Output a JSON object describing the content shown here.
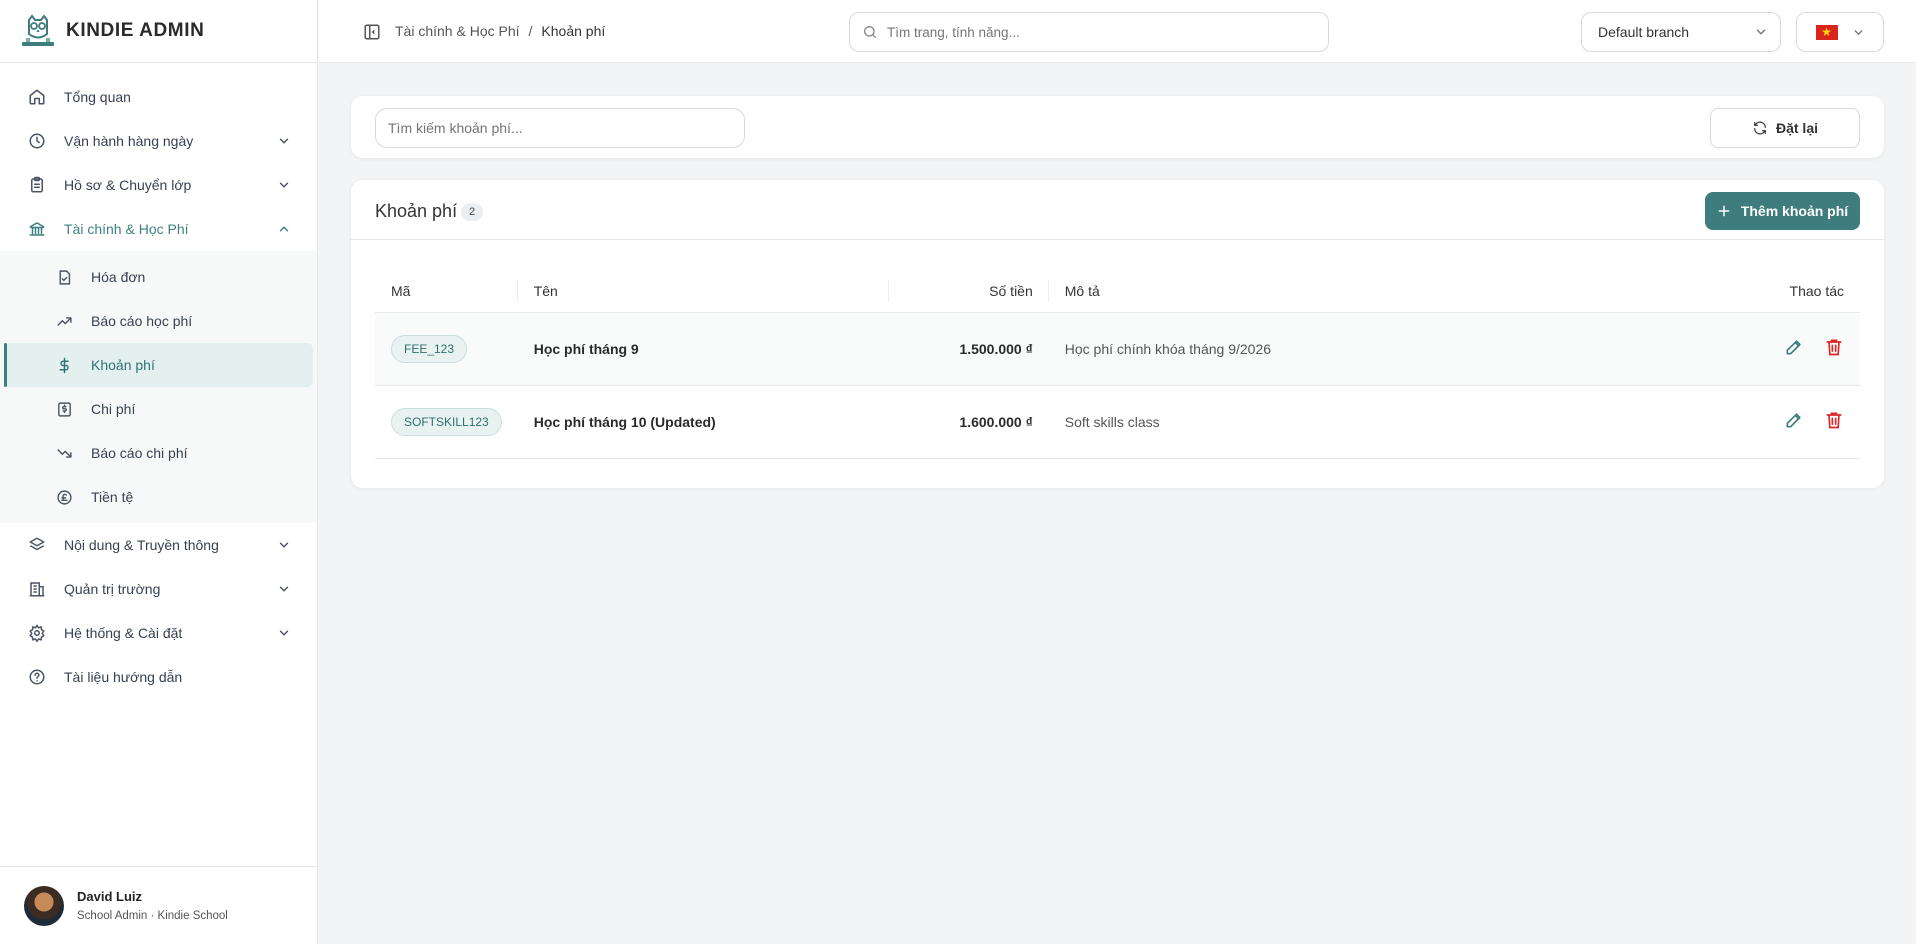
{
  "brand": {
    "name": "KINDIE ADMIN"
  },
  "sidebar": {
    "items": [
      {
        "label": "Tổng quan",
        "icon": "home-icon"
      },
      {
        "label": "Vận hành hàng ngày",
        "icon": "clock-icon"
      },
      {
        "label": "Hồ sơ & Chuyển lớp",
        "icon": "clipboard-icon"
      },
      {
        "label": "Tài chính & Học Phí",
        "icon": "bank-icon"
      },
      {
        "label": "Nội dung & Truyền thông",
        "icon": "layers-icon"
      },
      {
        "label": "Quản trị trường",
        "icon": "building-icon"
      },
      {
        "label": "Hệ thống & Cài đặt",
        "icon": "gear-icon"
      },
      {
        "label": "Tài liệu hướng dẫn",
        "icon": "help-circle-icon"
      }
    ],
    "finance_sub": [
      {
        "label": "Hóa đơn",
        "icon": "invoice-icon"
      },
      {
        "label": "Báo cáo học phí",
        "icon": "trending-up-icon"
      },
      {
        "label": "Khoản phí",
        "icon": "dollar-icon"
      },
      {
        "label": "Chi phí",
        "icon": "receipt-icon"
      },
      {
        "label": "Báo cáo chi phí",
        "icon": "trending-down-icon"
      },
      {
        "label": "Tiền tệ",
        "icon": "pound-icon"
      }
    ]
  },
  "user": {
    "name": "David Luiz",
    "role": "School Admin · Kindie School"
  },
  "topbar": {
    "breadcrumb": {
      "parent": "Tài chính & Học Phí",
      "separator": "/",
      "current": "Khoản phí"
    },
    "search_placeholder": "Tìm trang, tính năng...",
    "branch": "Default branch",
    "language_flag": "vietnam-flag"
  },
  "filters": {
    "search_placeholder": "Tìm kiếm khoản phí...",
    "reset_label": "Đặt lại"
  },
  "fees": {
    "title": "Khoản phí",
    "count": "2",
    "add_label": "Thêm khoản phí",
    "columns": [
      "Mã",
      "Tên",
      "Số tiền",
      "Mô tả",
      "Thao tác"
    ],
    "rows": [
      {
        "code": "FEE_123",
        "name": "Học phí tháng 9",
        "amount": "1.500.000 ₫",
        "description": "Học phí chính khóa tháng 9/2026"
      },
      {
        "code": "SOFTSKILL123",
        "name": "Học phí tháng 10 (Updated)",
        "amount": "1.600.000 ₫",
        "description": "Soft skills class"
      }
    ]
  },
  "colors": {
    "accent": "#3e7c7d",
    "danger": "#dc2626",
    "active_bg": "#e4efef"
  }
}
